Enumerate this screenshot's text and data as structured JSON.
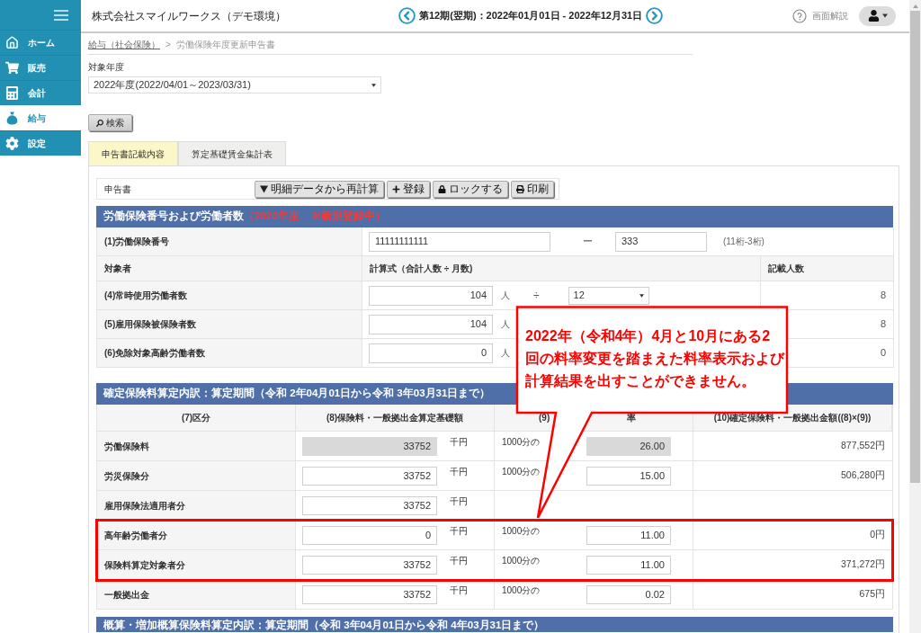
{
  "sidebar": {
    "items": [
      {
        "label": "ホーム",
        "selected": false
      },
      {
        "label": "販売",
        "selected": false
      },
      {
        "label": "会計",
        "selected": false
      },
      {
        "label": "給与",
        "selected": true
      },
      {
        "label": "設定",
        "selected": false
      }
    ]
  },
  "header": {
    "company": "株式会社スマイルワークス（デモ環境）",
    "period": "第12期(翌期)：2022年01月01日 - 2022年12月31日",
    "help": "画面解説"
  },
  "breadcrumb": {
    "items": [
      {
        "label": "給与（社会保険）",
        "kind": "link"
      },
      {
        "label": "労働保険年度更新申告書",
        "kind": "current"
      }
    ],
    "separator": ">"
  },
  "fiscal_year": {
    "label": "対象年度",
    "value": "2022年度(2022/04/01～2023/03/31)"
  },
  "search_button": "検索",
  "tabs": [
    {
      "label": "申告書記載内容",
      "selected": true
    },
    {
      "label": "算定基礎賃金集計表",
      "selected": false
    }
  ],
  "toolbar": {
    "title": "申告書",
    "buttons": [
      "明細データから再計算",
      "登録",
      "ロックする",
      "印刷"
    ]
  },
  "section_1": {
    "title": "労働保険番号および労働者数",
    "note": "（2020年度　※新規登録中）",
    "insurance_number": {
      "label": "(1)労働保険番号",
      "part_1": "11111111111",
      "separator": "ー",
      "part_2": "333",
      "hint": "(11桁-3桁)"
    },
    "columns": [
      "対象者",
      "計算式（合計人数 ÷ 月数)",
      "記載人数"
    ],
    "rows": [
      {
        "label": "(4)常時使用労働者数",
        "value": "104",
        "unit": "人",
        "operator": "÷",
        "months": "12",
        "count": "8"
      },
      {
        "label": "(5)雇用保険被保険者数",
        "value": "104",
        "unit": "人",
        "count": "8"
      },
      {
        "label": "(6)免除対象高齢労働者数",
        "value": "0",
        "unit": "人",
        "count": "0"
      }
    ]
  },
  "section_2": {
    "title": "確定保険料算定内訳：算定期間（令和 2年04月01日から令和 3年03月31日まで）",
    "columns": [
      {
        "label": "(7)区分"
      },
      {
        "label": "(8)保険料・一般拠出金算定基礎額"
      },
      {
        "label": "(9)",
        "label_end": "率"
      },
      {
        "label": "(10)確定保険料・一般拠出金額((8)×(9))"
      }
    ],
    "rows": [
      {
        "label": "労働保険料",
        "base": "33752",
        "base_unit": "千円",
        "rate_unit": "1000分の",
        "rate": "26.00",
        "amount": "877,552円",
        "disabled": true,
        "highlighted": false
      },
      {
        "label": "労災保険分",
        "base": "33752",
        "base_unit": "千円",
        "rate_unit": "1000分の",
        "rate": "15.00",
        "amount": "506,280円",
        "disabled": false,
        "highlighted": false
      },
      {
        "label": "雇用保険法適用者分",
        "base": "33752",
        "base_unit": "千円",
        "disabled": false,
        "highlighted": false
      },
      {
        "label": "高年齢労働者分",
        "base": "0",
        "base_unit": "千円",
        "rate_unit": "1000分の",
        "rate": "11.00",
        "amount": "0円",
        "disabled": false,
        "highlighted": true
      },
      {
        "label": "保険料算定対象者分",
        "base": "33752",
        "base_unit": "千円",
        "rate_unit": "1000分の",
        "rate": "11.00",
        "amount": "371,272円",
        "disabled": false,
        "highlighted": true
      },
      {
        "label": "一般拠出金",
        "base": "33752",
        "base_unit": "千円",
        "rate_unit": "1000分の",
        "rate": "0.02",
        "amount": "675円",
        "disabled": false,
        "highlighted": false
      }
    ]
  },
  "section_3": {
    "title": "概算・増加概算保険料算定内訳：算定期間（令和 3年04月01日から令和 4年03月31日まで）"
  },
  "callout": {
    "text": "2022年（令和4年）4月と10月にある2回の料率変更を踏まえた料率表示および計算結果を出すことができません。"
  }
}
